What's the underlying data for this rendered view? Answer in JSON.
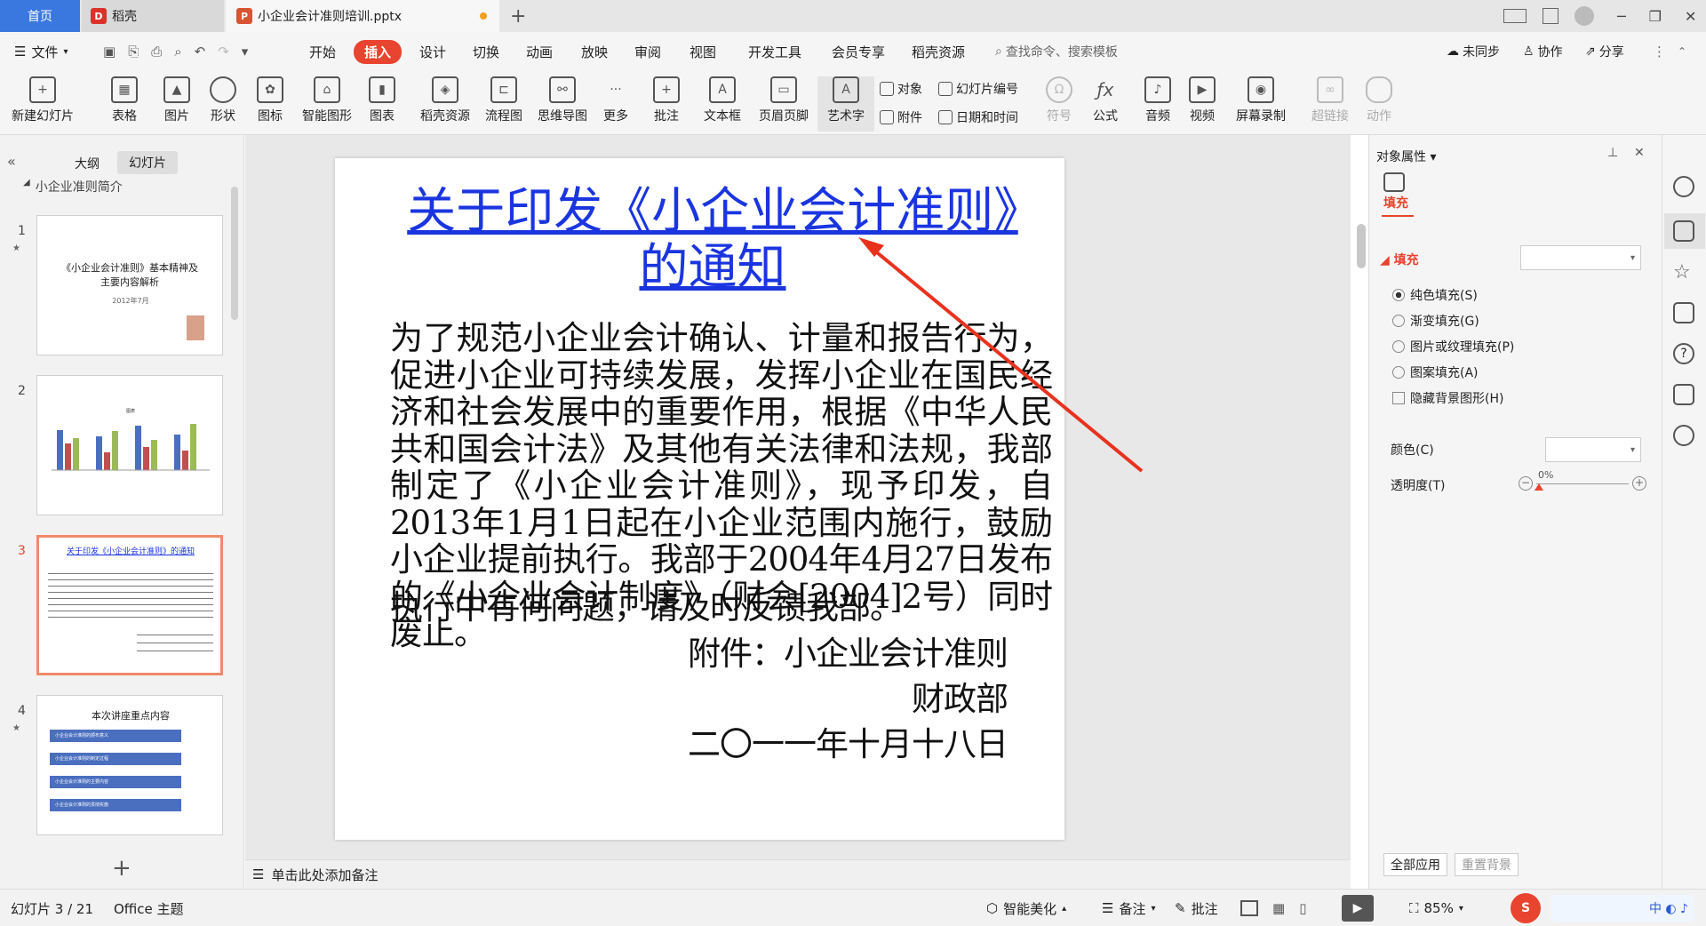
{
  "titlebar": {
    "home_tab": "首页",
    "daoke_tab": "稻壳",
    "doc_tab": "小企业会计准则培训.pptx"
  },
  "menu": {
    "file": "文件",
    "tabs": [
      "开始",
      "插入",
      "设计",
      "切换",
      "动画",
      "放映",
      "审阅",
      "视图",
      "开发工具",
      "会员专享",
      "稻壳资源"
    ],
    "search": "查找命令、搜索模板",
    "sync": "未同步",
    "collab": "协作",
    "share": "分享"
  },
  "ribbon": {
    "new_slide": "新建幻灯片",
    "table": "表格",
    "image": "图片",
    "shape": "形状",
    "icon": "图标",
    "smartart": "智能图形",
    "chart": "图表",
    "daoke_res": "稻壳资源",
    "flowchart": "流程图",
    "mindmap": "思维导图",
    "more": "更多",
    "comment": "批注",
    "textbox": "文本框",
    "header_footer": "页眉页脚",
    "wordart": "艺术字",
    "object": "对象",
    "attachment": "附件",
    "slide_number": "幻灯片编号",
    "date_time": "日期和时间",
    "symbol": "符号",
    "formula": "公式",
    "audio": "音频",
    "video": "视频",
    "screen_record": "屏幕录制",
    "hyperlink": "超链接",
    "animation": "动作"
  },
  "leftpanel": {
    "outline_tab": "大纲",
    "slides_tab": "幻灯片",
    "section": "小企业准则简介",
    "thumbs": [
      {
        "num": "1",
        "title": "《小企业会计准则》基本精神及主要内容解析",
        "date": "2012年7月"
      },
      {
        "num": "2",
        "title": "图表"
      },
      {
        "num": "3",
        "title": "关于印发《小企业会计准则》的通知"
      },
      {
        "num": "4",
        "title": "本次讲座重点内容",
        "items": [
          "小企业会计准则的颁布意义",
          "小企业会计准则的制定过程",
          "小企业会计准则的主要内容",
          "小企业会计准则的贯彻实施"
        ]
      }
    ],
    "add_slide": "+"
  },
  "slide": {
    "title": "关于印发《小企业会计准则》的通知",
    "body": "为了规范小企业会计确认、计量和报告行为，促进小企业可持续发展，发挥小企业在国民经济和社会发展中的重要作用，根据《中华人民共和国会计法》及其他有关法律和法规，我部制定了《小企业会计准则》，现予印发，自2013年1月1日起在小企业范围内施行，鼓励小企业提前执行。我部于2004年4月27日发布的《小企业会计制度》（财会[2004]2号）同时废止。",
    "line2": "执行中有何问题，请及时反馈我部。",
    "attachment": "附件：小企业会计准则",
    "org": "财政部",
    "date": "二〇一一年十月十八日"
  },
  "notes": {
    "placeholder": "单击此处添加备注"
  },
  "rightpanel": {
    "title": "对象属性",
    "fill_tab": "填充",
    "fill_section": "填充",
    "options": [
      "纯色填充(S)",
      "渐变填充(G)",
      "图片或纹理填充(P)",
      "图案填充(A)"
    ],
    "hide_bg": "隐藏背景图形(H)",
    "color_label": "颜色(C)",
    "transparency_label": "透明度(T)",
    "transparency_value": "0%",
    "apply_all": "全部应用",
    "reset_bg": "重置背景"
  },
  "status": {
    "slide_info": "幻灯片 3 / 21",
    "theme": "Office 主题",
    "beautify": "智能美化",
    "notes": "备注",
    "comment": "批注",
    "zoom": "85%"
  },
  "chart_colors": {
    "blue": "#4a6fbf",
    "red": "#c0504d",
    "green": "#9bbb59"
  },
  "accent": "#e8442f"
}
